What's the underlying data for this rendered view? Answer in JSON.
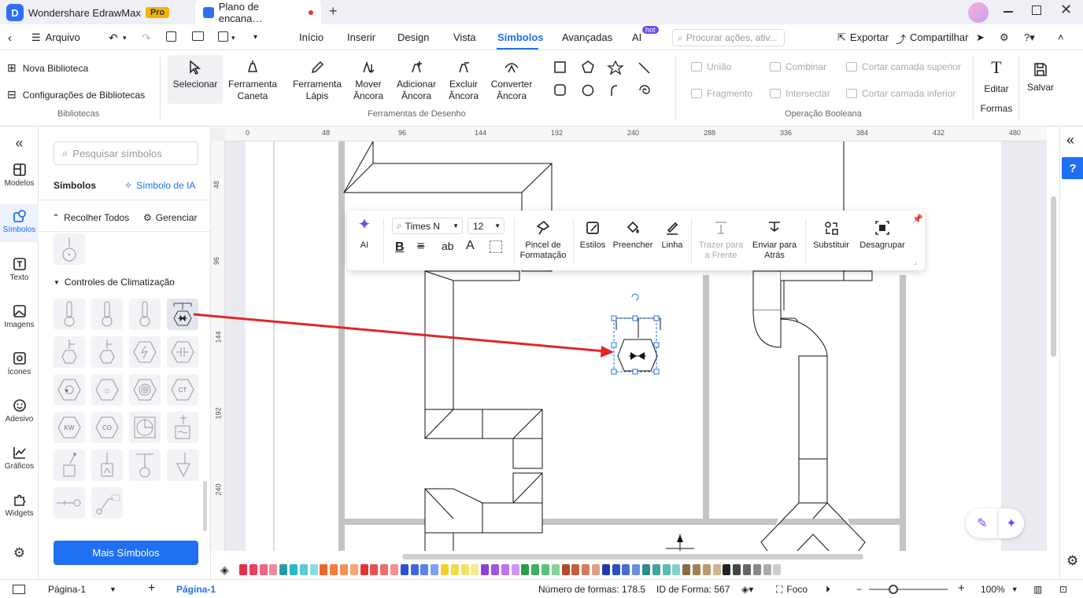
{
  "app": {
    "name": "Wondershare EdrawMax",
    "badge": "Pro"
  },
  "doc_tab": {
    "title": "Plano de encana…"
  },
  "menu": {
    "file": "Arquivo",
    "tabs": [
      "Início",
      "Inserir",
      "Design",
      "Vista",
      "Símbolos",
      "Avançadas",
      "AI"
    ],
    "active_tab": "Símbolos",
    "hot_badge": "hot",
    "search_placeholder": "Procurar ações, ativ...",
    "export": "Exportar",
    "share": "Compartilhar"
  },
  "ribbon": {
    "library": {
      "new": "Nova Biblioteca",
      "settings": "Configurações de Bibliotecas",
      "group": "Bibliotecas"
    },
    "draw_tools": [
      {
        "l1": "Selecionar",
        "l2": "",
        "icon": "cursor-icon"
      },
      {
        "l1": "Ferramenta",
        "l2": "Caneta",
        "icon": "pen-icon"
      },
      {
        "l1": "Ferramenta",
        "l2": "Lápis",
        "icon": "pencil-icon"
      },
      {
        "l1": "Mover",
        "l2": "Âncora",
        "icon": "move-anchor-icon"
      },
      {
        "l1": "Adicionar",
        "l2": "Âncora",
        "icon": "add-anchor-icon"
      },
      {
        "l1": "Excluir",
        "l2": "Âncora",
        "icon": "delete-anchor-icon"
      },
      {
        "l1": "Converter",
        "l2": "Âncora",
        "icon": "convert-anchor-icon"
      }
    ],
    "draw_group": "Ferramentas de Desenho",
    "boolean": {
      "union": "União",
      "combine": "Combinar",
      "cut_top": "Cortar camada superior",
      "fragment": "Fragmento",
      "intersect": "Intersectar",
      "cut_bottom": "Cortar camada inferior",
      "group": "Operação Booleana"
    },
    "edit_shapes": {
      "l1": "Editar",
      "l2": "Formas"
    },
    "save": "Salvar"
  },
  "left_bar": [
    "Modelos",
    "Símbolos",
    "Texto",
    "Imagens",
    "Ícones",
    "Adesivo",
    "Gráficos",
    "Widgets"
  ],
  "symbols_panel": {
    "search_placeholder": "Pesquisar símbolos",
    "title": "Símbolos",
    "ai_symbol": "Símbolo de IA",
    "collapse_all": "Recolher Todos",
    "manage": "Gerenciar",
    "category": "Controles de Climatização",
    "cell_labels": [
      "KW",
      "CO",
      "CT"
    ],
    "more": "Mais Símbolos"
  },
  "rulers": {
    "h": [
      "0",
      "48",
      "96",
      "144",
      "192",
      "240",
      "288",
      "336",
      "384",
      "432",
      "480"
    ],
    "v": [
      "48",
      "96",
      "144",
      "192",
      "240"
    ]
  },
  "context_toolbar": {
    "ai": "AI",
    "font": "Times N",
    "size": "12",
    "format_painter": {
      "l1": "Pincel de",
      "l2": "Formatação"
    },
    "styles": "Estilos",
    "fill": "Preencher",
    "line": "Linha",
    "bring_front": {
      "l1": "Trazer para",
      "l2": "a Frente"
    },
    "send_back": {
      "l1": "Enviar para",
      "l2": "Atrás"
    },
    "replace": "Substituir",
    "ungroup": "Desagrupar"
  },
  "colors": {
    "accent": "#1f6ff2",
    "arrow": "#e0262b",
    "selection": "#1f6ff2",
    "pipe_gray": "#c4c4c4",
    "palette": [
      "#e0304a",
      "#e8425e",
      "#f06580",
      "#ec8aa0",
      "#2b9aa8",
      "#28b8c8",
      "#5ccad6",
      "#88dde2",
      "#f0662a",
      "#f27a3e",
      "#f59058",
      "#f6a674",
      "#e33434",
      "#e85050",
      "#ee6e6e",
      "#f49090",
      "#2e4fd0",
      "#3f66e0",
      "#5a82ea",
      "#7ea0f0",
      "#f2d02a",
      "#f4da48",
      "#f6e26a",
      "#f8ea90",
      "#8a3fd8",
      "#a056e2",
      "#b876ea",
      "#cc98f0",
      "#2f9a48",
      "#3fb05c",
      "#5cc276",
      "#86d49a",
      "#b04a2a",
      "#c2603e",
      "#d07e5e",
      "#dea08a",
      "#1f3aa8",
      "#2c50c0",
      "#4670d0",
      "#6a90dc",
      "#2c8c88",
      "#3aa49e",
      "#5cbab4",
      "#86d0ca",
      "#8a6a40",
      "#a08052",
      "#b89a6e",
      "#cdb692",
      "#222222",
      "#444444",
      "#666666",
      "#888888",
      "#aaaaaa",
      "#cccccc"
    ]
  },
  "status": {
    "page_dropdown": "Página-1",
    "page_tab": "Página-1",
    "shape_count": "Número de formas: 178.5",
    "shape_id": "ID de Forma: 567",
    "focus": "Foco",
    "zoom": "100%"
  }
}
